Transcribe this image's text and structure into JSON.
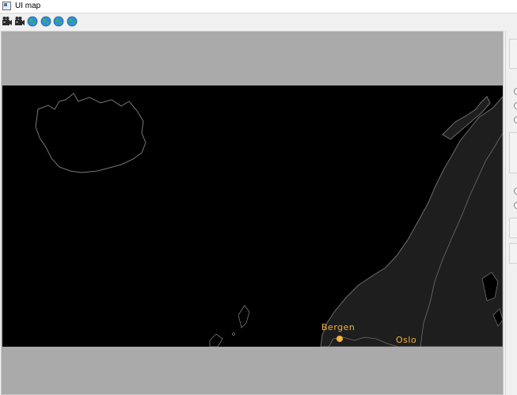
{
  "window": {
    "title": "UI map"
  },
  "toolbar": {
    "buttons": [
      {
        "icon": "film-camera-icon"
      },
      {
        "icon": "film-camera-icon"
      },
      {
        "icon": "globe-icon"
      },
      {
        "icon": "globe-icon"
      },
      {
        "icon": "globe-icon"
      },
      {
        "icon": "globe-icon"
      }
    ]
  },
  "map": {
    "cities": [
      {
        "name": "Bergen",
        "marker_color": "#f4b33b"
      },
      {
        "name": "Oslo",
        "marker_color": "#f4b33b"
      }
    ],
    "colors": {
      "ocean": "#000000",
      "land": "#1e1e1e",
      "border": "#6e6e6e",
      "frame_fill": "#aaaaaa"
    }
  }
}
